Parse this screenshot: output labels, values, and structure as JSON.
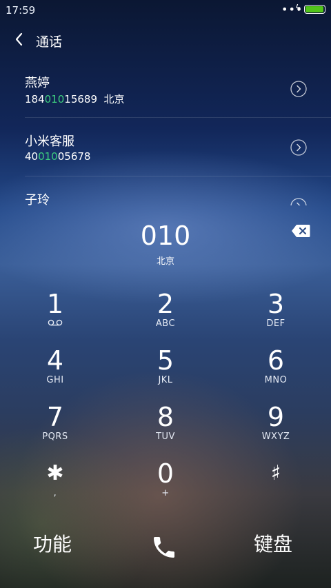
{
  "status_bar": {
    "time": "17:59",
    "dots": "•••",
    "bolt": "ϟ",
    "battery_color": "#52c41a"
  },
  "header": {
    "title": "通话",
    "back_icon": "chevron-left-icon"
  },
  "contacts": [
    {
      "name": "燕婷",
      "number_pre": "184",
      "number_match": "010",
      "number_post": "15689",
      "location": "北京"
    },
    {
      "name": "小米客服",
      "number_pre": "40",
      "number_match": "010",
      "number_post": "05678",
      "location": ""
    },
    {
      "name": "子玲",
      "number_pre": "",
      "number_match": "",
      "number_post": "",
      "location": ""
    }
  ],
  "dial": {
    "number": "010",
    "location": "北京"
  },
  "keypad": [
    {
      "digit": "1",
      "letters": ""
    },
    {
      "digit": "2",
      "letters": "ABC"
    },
    {
      "digit": "3",
      "letters": "DEF"
    },
    {
      "digit": "4",
      "letters": "GHI"
    },
    {
      "digit": "5",
      "letters": "JKL"
    },
    {
      "digit": "6",
      "letters": "MNO"
    },
    {
      "digit": "7",
      "letters": "PQRS"
    },
    {
      "digit": "8",
      "letters": "TUV"
    },
    {
      "digit": "9",
      "letters": "WXYZ"
    },
    {
      "digit": "✱",
      "letters": ","
    },
    {
      "digit": "0",
      "letters": "+"
    },
    {
      "digit": "♯",
      "letters": ""
    }
  ],
  "bottom": {
    "function_label": "功能",
    "keyboard_label": "键盘"
  },
  "colors": {
    "match_highlight": "#3ecf7f"
  }
}
